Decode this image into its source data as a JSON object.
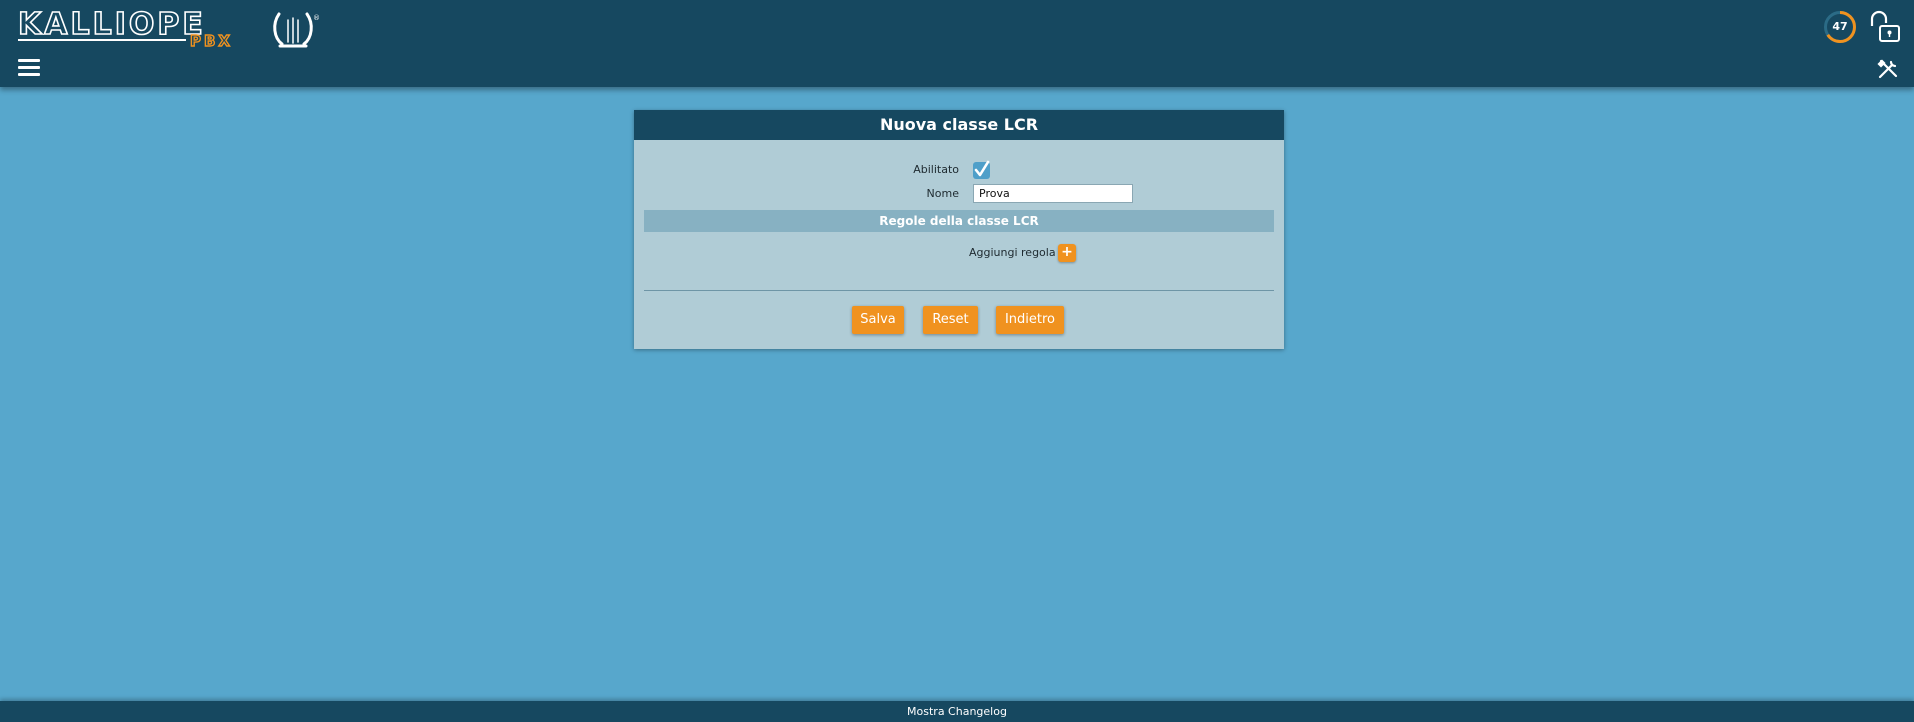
{
  "header": {
    "logo_text": "KALLIOPE",
    "logo_subtext": "PBX",
    "timer_value": "47",
    "icons": {
      "menu": "hamburger-menu-icon",
      "timer": "session-timer-icon",
      "lock": "unlocked-padlock-icon",
      "tools": "tools-icon"
    }
  },
  "panel": {
    "title": "Nuova classe LCR",
    "fields": {
      "enabled_label": "Abilitato",
      "enabled_checked": true,
      "name_label": "Nome",
      "name_value": "Prova"
    },
    "rules_section_title": "Regole della classe LCR",
    "add_rule_label": "Aggiungi regola",
    "add_rule_button": "+",
    "buttons": {
      "save": "Salva",
      "reset": "Reset",
      "back": "Indietro"
    }
  },
  "footer": {
    "changelog_label": "Mostra Changelog"
  },
  "colors": {
    "page_background": "#57a7cc",
    "header_background": "#164860",
    "panel_background": "#b0ccd6",
    "section_bar": "#87b1c2",
    "accent_orange": "#f0921f"
  }
}
